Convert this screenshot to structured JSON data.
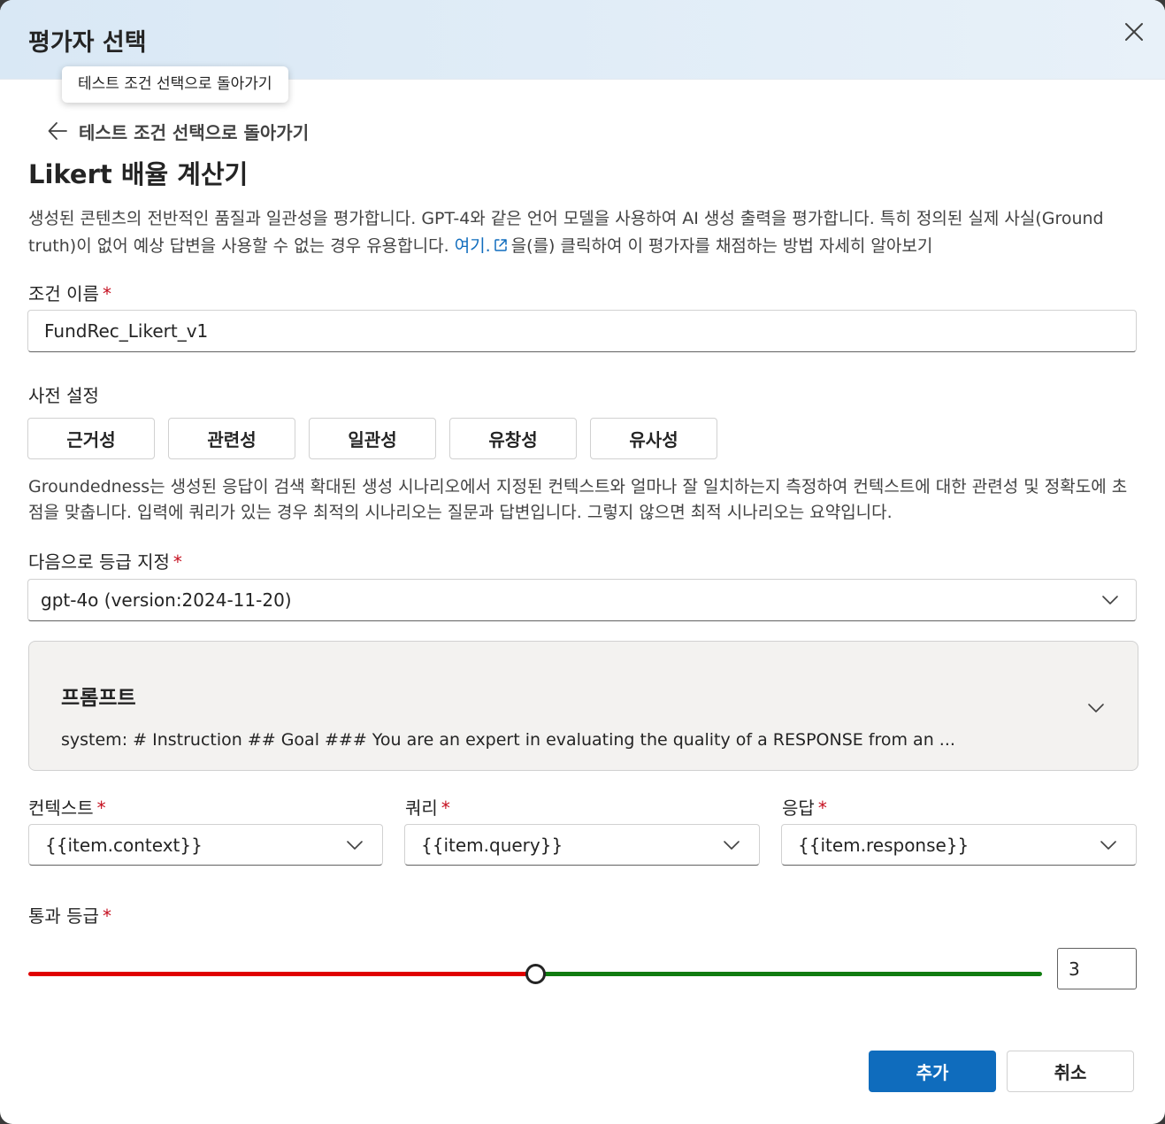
{
  "dialog": {
    "title": "평가자 선택",
    "close_icon": "close-icon"
  },
  "tooltip": {
    "text": "테스트 조건 선택으로 돌아가기"
  },
  "back": {
    "label": "테스트 조건 선택으로 돌아가기",
    "icon": "arrow-left-icon"
  },
  "evaluator": {
    "title": "Likert 배율 계산기",
    "description_part1": "생성된 콘텐츠의 전반적인 품질과 일관성을 평가합니다. GPT-4와 같은 언어 모델을 사용하여 AI 생성 출력을 평가합니다. 특히 정의된 실제 사실(Ground truth)이 없어 예상 답변을 사용할 수 없는 경우 유용합니다. ",
    "link_text": "여기.",
    "link_icon": "external-link-icon",
    "description_part2": "을(를) 클릭하여 이 평가자를 채점하는 방법 자세히 알아보기"
  },
  "criteria_name": {
    "label": "조건 이름",
    "required_mark": "*",
    "value": "FundRec_Likert_v1"
  },
  "presets": {
    "label": "사전 설정",
    "buttons": [
      "근거성",
      "관련성",
      "일관성",
      "유창성",
      "유사성"
    ],
    "description": "Groundedness는 생성된 응답이 검색 확대된 생성 시나리오에서 지정된 컨텍스트와 얼마나 잘 일치하는지 측정하여 컨텍스트에 대한 관련성 및 정확도에 초점을 맞춥니다. 입력에 쿼리가 있는 경우 최적의 시나리오는 질문과 답변입니다. 그렇지 않으면 최적 시나리오는 요약입니다."
  },
  "grade_with": {
    "label": "다음으로 등급 지정",
    "required_mark": "*",
    "value": "gpt-4o (version:2024-11-20)"
  },
  "prompt": {
    "title": "프롬프트",
    "preview": "system: # Instruction ## Goal ### You are an expert in evaluating the quality of a RESPONSE from an ..."
  },
  "mappings": {
    "context": {
      "label": "컨텍스트",
      "required_mark": "*",
      "value": "{{item.context}}"
    },
    "query": {
      "label": "쿼리",
      "required_mark": "*",
      "value": "{{item.query}}"
    },
    "response": {
      "label": "응답",
      "required_mark": "*",
      "value": "{{item.response}}"
    }
  },
  "pass_grade": {
    "label": "통과 등급",
    "required_mark": "*",
    "value": "3",
    "min": 1,
    "max": 5,
    "fail_color": "#e00000",
    "pass_color": "#107c10"
  },
  "actions": {
    "add_label": "추가",
    "cancel_label": "취소",
    "primary_color": "#0f6cbd"
  }
}
